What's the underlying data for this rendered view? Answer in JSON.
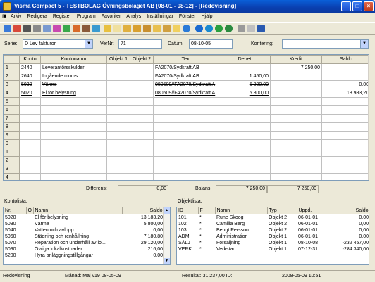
{
  "window": {
    "title": "Visma Compact 5 - TESTBOLAG Övningsbolaget AB [08-01 - 08-12] - [Redovisning]",
    "minimize": "_",
    "restore": "□",
    "close": "×"
  },
  "menu": [
    "Arkiv",
    "Redigera",
    "Register",
    "Program",
    "Favoriter",
    "Analys",
    "Inställningar",
    "Fönster",
    "Hjälp"
  ],
  "form": {
    "serie_label": "Serie:",
    "serie_value": "D Lev fakturor",
    "vernr_label": "VerNr:",
    "vernr_value": "71",
    "datum_label": "Datum:",
    "datum_value": "08-10-05",
    "kontering_label": "Kontering:",
    "kontering_value": ""
  },
  "grid": {
    "headers": [
      "",
      "Konto",
      "Kontonamn",
      "Objekt 1",
      "Objekt 2",
      "Text",
      "Debet",
      "Kredit",
      "Saldo"
    ],
    "rows": [
      {
        "n": "1",
        "konto": "2440",
        "namn": "Leverantörsskulder",
        "o1": "",
        "o2": "",
        "text": "FA2070/Sydkraft AB",
        "debet": "",
        "kredit": "7 250,00",
        "saldo": "",
        "style": ""
      },
      {
        "n": "2",
        "konto": "2640",
        "namn": "Ingående moms",
        "o1": "",
        "o2": "",
        "text": "FA2070/Sydkraft AB",
        "debet": "1 450,00",
        "kredit": "",
        "saldo": "",
        "style": "sep"
      },
      {
        "n": "3",
        "konto": "5030",
        "namn": "Värme",
        "o1": "",
        "o2": "",
        "text": "080509//FA2070/Sydkraft A",
        "debet": "5 800,00",
        "kredit": "",
        "saldo": "0,00",
        "style": "strike"
      },
      {
        "n": "4",
        "konto": "5020",
        "namn": "El för belysning",
        "o1": "",
        "o2": "",
        "text": "080509//FA2070/Sydkraft A",
        "debet": "5 800,00",
        "kredit": "",
        "saldo": "18 983,20",
        "style": "ul"
      },
      {
        "n": "5",
        "konto": "",
        "namn": "",
        "o1": "",
        "o2": "",
        "text": "",
        "debet": "",
        "kredit": "",
        "saldo": "",
        "style": ""
      },
      {
        "n": "6",
        "konto": "",
        "namn": "",
        "o1": "",
        "o2": "",
        "text": "",
        "debet": "",
        "kredit": "",
        "saldo": "",
        "style": ""
      },
      {
        "n": "7",
        "konto": "",
        "namn": "",
        "o1": "",
        "o2": "",
        "text": "",
        "debet": "",
        "kredit": "",
        "saldo": "",
        "style": ""
      },
      {
        "n": "8",
        "konto": "",
        "namn": "",
        "o1": "",
        "o2": "",
        "text": "",
        "debet": "",
        "kredit": "",
        "saldo": "",
        "style": ""
      },
      {
        "n": "9",
        "konto": "",
        "namn": "",
        "o1": "",
        "o2": "",
        "text": "",
        "debet": "",
        "kredit": "",
        "saldo": "",
        "style": ""
      },
      {
        "n": "0",
        "konto": "",
        "namn": "",
        "o1": "",
        "o2": "",
        "text": "",
        "debet": "",
        "kredit": "",
        "saldo": "",
        "style": ""
      },
      {
        "n": "1",
        "konto": "",
        "namn": "",
        "o1": "",
        "o2": "",
        "text": "",
        "debet": "",
        "kredit": "",
        "saldo": "",
        "style": ""
      },
      {
        "n": "2",
        "konto": "",
        "namn": "",
        "o1": "",
        "o2": "",
        "text": "",
        "debet": "",
        "kredit": "",
        "saldo": "",
        "style": ""
      },
      {
        "n": "3",
        "konto": "",
        "namn": "",
        "o1": "",
        "o2": "",
        "text": "",
        "debet": "",
        "kredit": "",
        "saldo": "",
        "style": ""
      },
      {
        "n": "4",
        "konto": "",
        "namn": "",
        "o1": "",
        "o2": "",
        "text": "",
        "debet": "",
        "kredit": "",
        "saldo": "",
        "style": ""
      }
    ]
  },
  "totals": {
    "diff_label": "Differens:",
    "diff_value": "0,00",
    "balans_label": "Balans:",
    "balans_debet": "7 250,00",
    "balans_kredit": "7 250,00"
  },
  "kontolista": {
    "title": "Kontolista:",
    "headers": [
      "Nr.",
      "O",
      "Namn",
      "Saldo"
    ],
    "rows": [
      [
        "5020",
        "",
        "El för belysning",
        "13 183,20"
      ],
      [
        "5030",
        "",
        "Värme",
        "5 800,00"
      ],
      [
        "5040",
        "",
        "Vatten och avlopp",
        "0,00"
      ],
      [
        "5060",
        "",
        "Städning och renhållning",
        "7 180,80"
      ],
      [
        "5070",
        "",
        "Reparation och underhåll av lo...",
        "29 120,00"
      ],
      [
        "5090",
        "",
        "Övriga lokalkostnader",
        "216,00"
      ],
      [
        "5200",
        "",
        "Hyra anläggningstillgångar",
        "0,00"
      ]
    ]
  },
  "objektlista": {
    "title": "Objektlista:",
    "headers": [
      "ID",
      "F",
      "Namn",
      "Typ",
      "Uppd.",
      "Saldo"
    ],
    "rows": [
      [
        "101",
        "*",
        "Rune Skoog",
        "Objekt 2",
        "06-01-01",
        "0,00"
      ],
      [
        "102",
        "*",
        "Camilla Berg",
        "Objekt 2",
        "06-01-01",
        "0,00"
      ],
      [
        "103",
        "*",
        "Bengt Persson",
        "Objekt 2",
        "06-01-01",
        "0,00"
      ],
      [
        "ADM",
        "*",
        "Administration",
        "Objekt 1",
        "06-01-01",
        "0,00"
      ],
      [
        "SÄLJ",
        "*",
        "Försäljning",
        "Objekt 1",
        "08-10-08",
        "-232 457,00"
      ],
      [
        "VERK",
        "*",
        "Verkstad",
        "Objekt 1",
        "07-12-31",
        "-284 340,00"
      ]
    ]
  },
  "status": {
    "mode": "Redovisning",
    "period": "Månad: Maj  v19  08-05-09",
    "resultat": "Resultat:  31 237,00  ID:",
    "datetime": "2008-05-09   10:51"
  },
  "icons": [
    "toolbar-icons-various"
  ]
}
